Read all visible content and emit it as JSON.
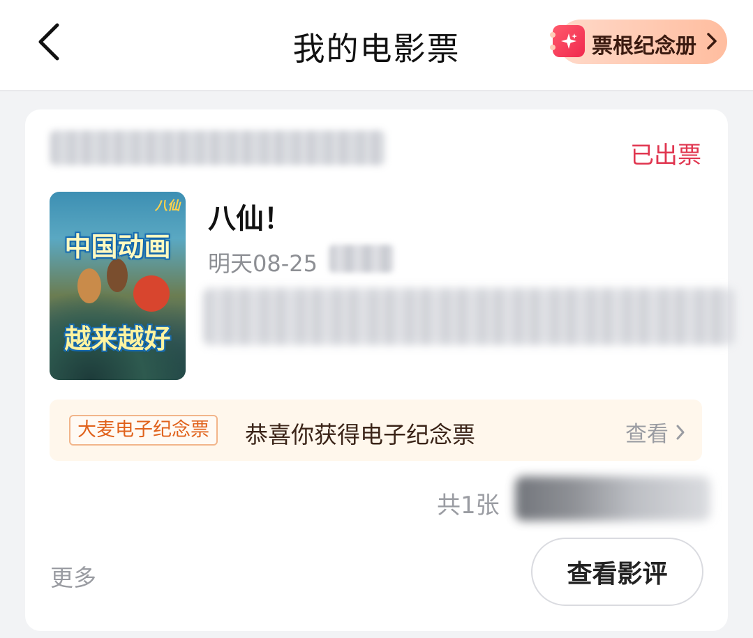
{
  "header": {
    "title": "我的电影票",
    "album_button_label": "票根纪念册"
  },
  "ticket": {
    "status": "已出票",
    "movie_title": "八仙！",
    "show_time": "明天08-25",
    "poster": {
      "logo_text": "八仙",
      "headline_line1": "中国动画",
      "headline_line2": "越来越好"
    },
    "promo": {
      "badge": "大麦电子纪念票",
      "text": "恭喜你获得电子纪念票",
      "link_label": "查看"
    },
    "count_label": "共1张",
    "more_label": "更多",
    "review_button_label": "查看影评"
  },
  "colors": {
    "status_red": "#e0354f",
    "promo_orange": "#e0621c",
    "promo_bg": "#fff7ec",
    "album_gradient_start": "#ffd9c9",
    "album_gradient_end": "#ffbd9f"
  }
}
